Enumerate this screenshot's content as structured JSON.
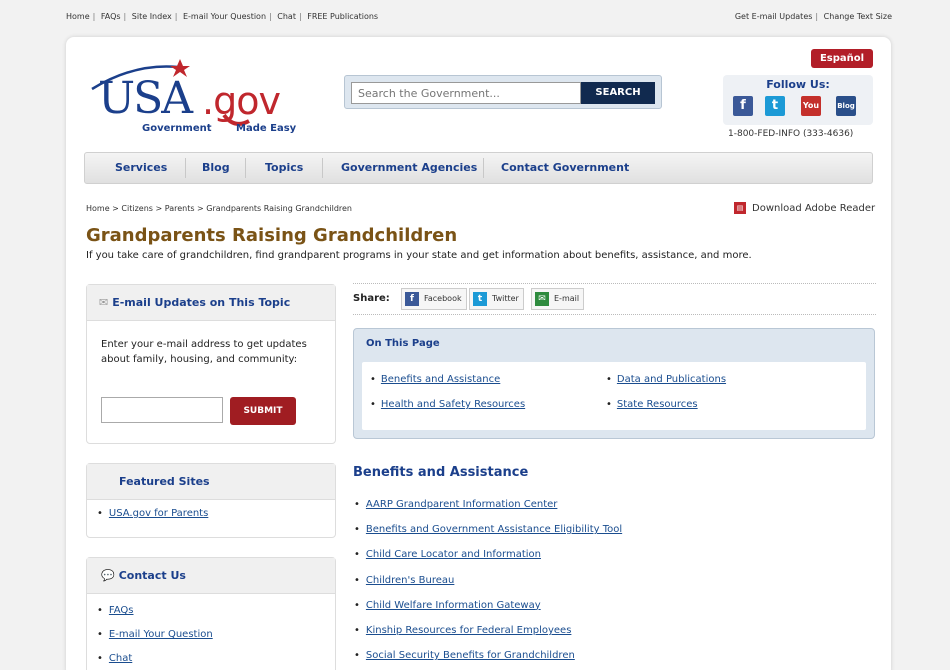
{
  "topbar": {
    "left_links": [
      "Home",
      "FAQs",
      "Site Index",
      "E-mail Your Question",
      "Chat",
      "FREE Publications"
    ],
    "right_links": [
      "Get E-mail Updates",
      "Change Text Size"
    ]
  },
  "header": {
    "logo_main": "USA",
    "logo_gov": ".gov",
    "logo_tag1": "Government",
    "logo_tag2": "Made Easy",
    "search_placeholder": "Search the Government...",
    "search_button": "SEARCH",
    "espanol_button": "Español",
    "follow_title": "Follow Us:",
    "social_icons": [
      "facebook-icon",
      "twitter-icon",
      "youtube-icon",
      "blog-icon"
    ],
    "phone": "1-800-FED-INFO (333-4636)"
  },
  "nav": {
    "items": [
      "Services",
      "Blog",
      "Topics",
      "Government Agencies",
      "Contact Government"
    ]
  },
  "breadcrumb": "Home > Citizens > Parents > Grandparents Raising Grandchildren",
  "adobe_link": "Download Adobe Reader",
  "page": {
    "title": "Grandparents Raising Grandchildren",
    "intro": "If you take care of grandchildren, find grandparent programs in your state and get information about benefits, assistance, and more."
  },
  "email_box": {
    "title": "E-mail Updates on This Topic",
    "text": "Enter your e-mail address to get updates about family, housing, and community:",
    "submit": "SUBMIT"
  },
  "featured": {
    "title": "Featured Sites",
    "links": [
      "USA.gov for Parents"
    ]
  },
  "contact": {
    "title": "Contact Us",
    "links": [
      "FAQs",
      "E-mail Your Question",
      "Chat"
    ]
  },
  "share": {
    "label": "Share:",
    "buttons": [
      "Facebook",
      "Twitter",
      "E-mail"
    ]
  },
  "on_this_page": {
    "title": "On This Page",
    "links": [
      "Benefits and Assistance",
      "Health and Safety Resources",
      "Data and Publications",
      "State Resources"
    ]
  },
  "benefits": {
    "title": "Benefits and Assistance",
    "links": [
      "AARP Grandparent Information Center",
      "Benefits and Government Assistance Eligibility Tool",
      "Child Care Locator and Information",
      "Children's Bureau",
      "Child Welfare Information Gateway",
      "Kinship Resources for Federal Employees",
      "Social Security Benefits for Grandchildren"
    ]
  },
  "colors": {
    "brand_blue": "#1b3f8b",
    "brand_red": "#c0272d",
    "title_brown": "#7a5316",
    "submit_red": "#a01d22"
  }
}
